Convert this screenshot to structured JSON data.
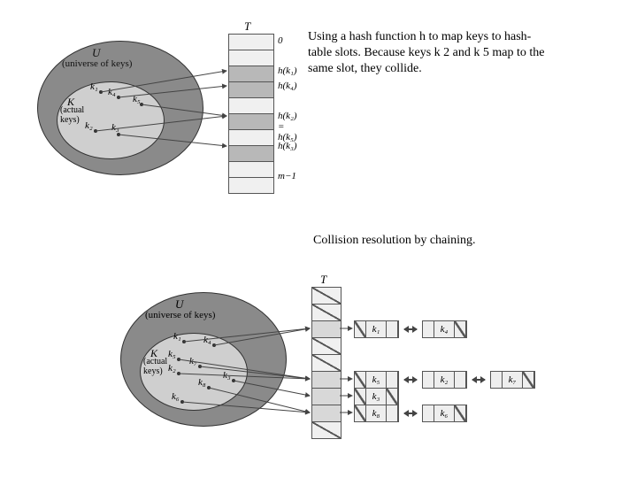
{
  "caption1": "Using a hash function h to map keys to hash-table slots. Because keys k 2 and k 5 map to the same slot, they collide.",
  "caption2": "Collision resolution by chaining.",
  "U_label": "U",
  "U_sub": "(universe of keys)",
  "K_label": "K",
  "K_sub": "(actual\nkeys)",
  "T_label": "T",
  "diag1": {
    "keys": [
      "k₁",
      "k₂",
      "k₃",
      "k₄",
      "k₅"
    ],
    "slotCount": 10,
    "filledSlots": [
      2,
      3,
      5,
      7
    ],
    "labels": {
      "0": "0",
      "2": "h(k₁)",
      "3": "h(k₄)",
      "5": "h(k₂) = h(k₅)",
      "7": "h(k₃)",
      "9": "m−1"
    }
  },
  "diag2": {
    "keys": [
      "k₁",
      "k₂",
      "k₃",
      "k₄",
      "k₅",
      "k₆",
      "k₇",
      "k₈"
    ],
    "slotCount": 9,
    "diagSlots": [
      0,
      1,
      3,
      4,
      8
    ],
    "ptrSlots": [
      2,
      5,
      6,
      7
    ],
    "chains": {
      "2": [
        "k₁",
        "k₄"
      ],
      "5": [
        "k₅",
        "k₂",
        "k₇"
      ],
      "6": [
        "k₃"
      ],
      "7": [
        "k₈",
        "k₆"
      ]
    }
  }
}
